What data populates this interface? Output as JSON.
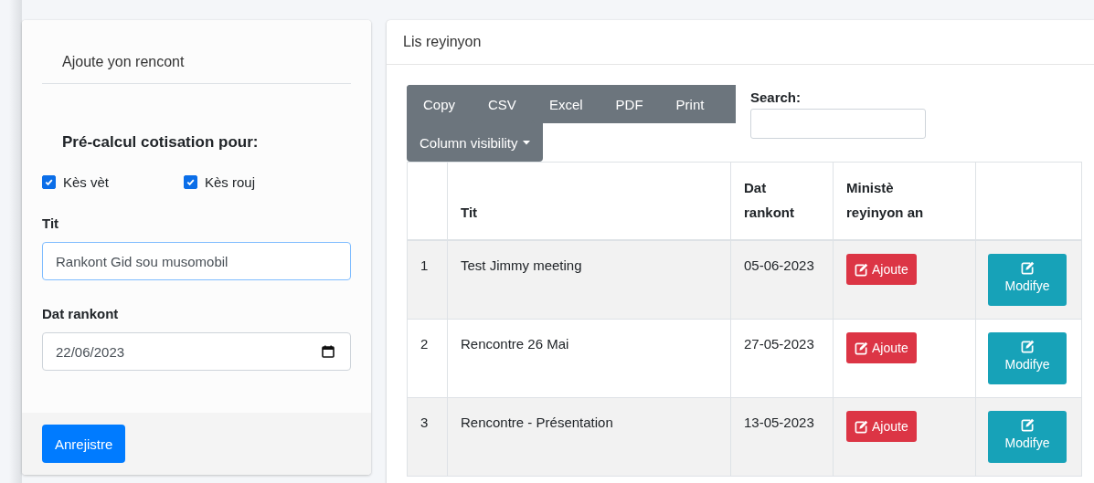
{
  "form_card": {
    "title": "Ajoute yon rencont",
    "section_heading": "Pré-calcul cotisation pour:",
    "checkboxes": [
      {
        "label": "Kès vèt",
        "checked": true
      },
      {
        "label": "Kès rouj",
        "checked": true
      }
    ],
    "title_field": {
      "label": "Tit",
      "value": "Rankont Gid sou musomobil"
    },
    "date_field": {
      "label": "Dat rankont",
      "value": "22/06/2023"
    },
    "save_button": "Anrejistre"
  },
  "list_card": {
    "title": "Lis reyinyon",
    "export_buttons": [
      "Copy",
      "CSV",
      "Excel",
      "PDF",
      "Print"
    ],
    "column_visibility_button": "Column visibility",
    "search": {
      "label": "Search:"
    },
    "table": {
      "columns": [
        "",
        "Tit",
        "Dat rankont",
        "Ministè reyinyon an",
        ""
      ],
      "rows": [
        {
          "number": "1",
          "title": "Test Jimmy meeting",
          "date": "05-06-2023",
          "add_button": "Ajoute",
          "edit_button": "Modifye"
        },
        {
          "number": "2",
          "title": "Rencontre 26 Mai",
          "date": "27-05-2023",
          "add_button": "Ajoute",
          "edit_button": "Modifye"
        },
        {
          "number": "3",
          "title": "Rencontre - Présentation",
          "date": "13-05-2023",
          "add_button": "Ajoute",
          "edit_button": "Modifye"
        }
      ]
    }
  }
}
